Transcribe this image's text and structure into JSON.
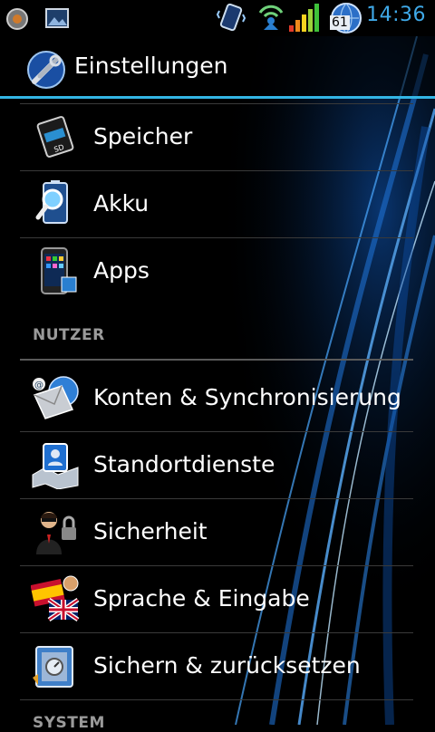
{
  "status_bar": {
    "time": "14:36",
    "battery_level": "61",
    "icons": [
      "notification-circle-icon",
      "image-icon",
      "phone-vibrate-icon",
      "wifi-hotspot-icon",
      "signal-bars-icon",
      "battery-globe-icon"
    ]
  },
  "action_bar": {
    "title": "Einstellungen",
    "icon": "settings-wrench-icon"
  },
  "sections": {
    "nutzer": "NUTZER",
    "system": "SYSTEM"
  },
  "items": [
    {
      "label": "Speicher",
      "icon": "sd-card-icon"
    },
    {
      "label": "Akku",
      "icon": "battery-magnifier-icon"
    },
    {
      "label": "Apps",
      "icon": "phone-apps-icon"
    },
    {
      "label": "Konten & Synchronisierung",
      "icon": "mail-globe-icon"
    },
    {
      "label": "Standortdienste",
      "icon": "location-map-icon"
    },
    {
      "label": "Sicherheit",
      "icon": "agent-lock-icon"
    },
    {
      "label": "Sprache & Eingabe",
      "icon": "flags-icon"
    },
    {
      "label": "Sichern & zurücksetzen",
      "icon": "backup-safe-icon"
    }
  ],
  "colors": {
    "accent": "#33b5e5",
    "clock": "#3fa9e8",
    "background": "#000000",
    "section_text": "#9a9a9a"
  }
}
